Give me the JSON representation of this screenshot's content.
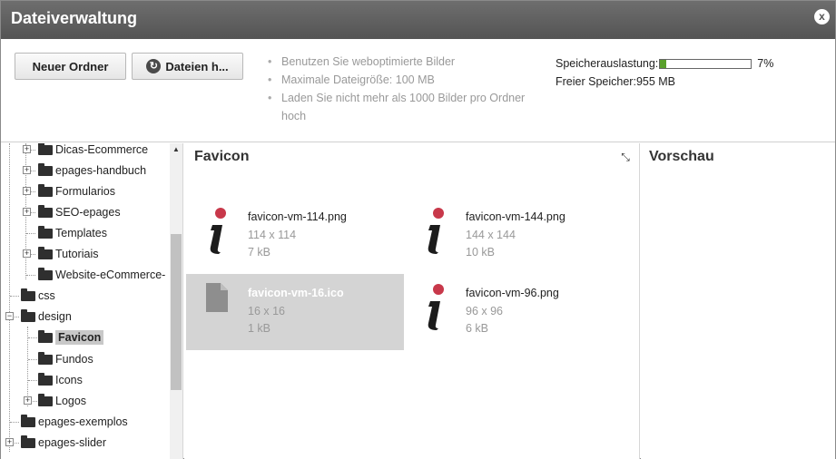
{
  "window": {
    "title": "Dateiverwaltung",
    "close_label": "x"
  },
  "toolbar": {
    "new_folder_label": "Neuer Ordner",
    "upload_label": "Dateien h...",
    "hints": [
      "Benutzen Sie weboptimierte Bilder",
      "Maximale Dateigröße: 100 MB",
      "Laden Sie nicht mehr als 1000 Bilder pro Ordner hoch"
    ]
  },
  "storage": {
    "usage_label": "Speicherauslastung:",
    "usage_percent_label": "7%",
    "usage_fraction": 0.07,
    "free_label": "Freier Speicher:",
    "free_value": "955 MB",
    "bar_color": "#5aa02c"
  },
  "tree": {
    "items": [
      {
        "label": "Dicas-Ecommerce",
        "expandable": true
      },
      {
        "label": "epages-handbuch",
        "expandable": true
      },
      {
        "label": "Formularios",
        "expandable": true
      },
      {
        "label": "SEO-epages",
        "expandable": true
      },
      {
        "label": "Templates",
        "expandable": false
      },
      {
        "label": "Tutoriais",
        "expandable": true
      },
      {
        "label": "Website-eCommerce-",
        "expandable": false
      },
      {
        "label": "css",
        "expandable": false
      },
      {
        "label": "design",
        "expandable": true,
        "expanded": true
      },
      {
        "label": "Favicon",
        "selected": true
      },
      {
        "label": "Fundos",
        "expandable": false
      },
      {
        "label": "Icons",
        "expandable": false
      },
      {
        "label": "Logos",
        "expandable": true
      },
      {
        "label": "epages-exemplos",
        "expandable": false
      },
      {
        "label": "epages-slider",
        "expandable": true
      }
    ]
  },
  "files": {
    "heading": "Favicon",
    "items": [
      {
        "name": "favicon-vm-114.png",
        "dims": "114 x 114",
        "size": "7 kB",
        "icon": "info-icon"
      },
      {
        "name": "favicon-vm-144.png",
        "dims": "144 x 144",
        "size": "10 kB",
        "icon": "info-icon"
      },
      {
        "name": "favicon-vm-16.ico",
        "dims": "16 x 16",
        "size": "1 kB",
        "icon": "document-icon",
        "selected": true
      },
      {
        "name": "favicon-vm-96.png",
        "dims": "96 x 96",
        "size": "6 kB",
        "icon": "info-icon"
      }
    ]
  },
  "preview": {
    "heading": "Vorschau"
  },
  "colors": {
    "titlebar": "#5e5e5e",
    "selection": "#d4d4d4",
    "icon_dot": "#c8384a"
  }
}
